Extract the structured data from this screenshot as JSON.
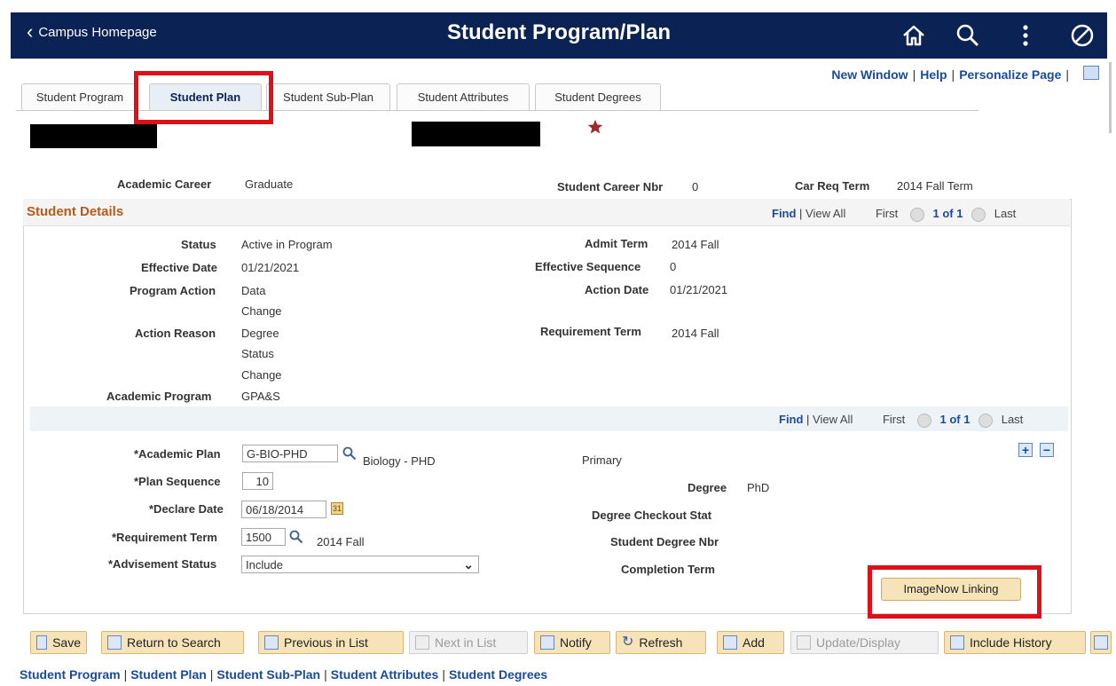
{
  "header": {
    "back_label": "Campus Homepage",
    "title": "Student Program/Plan"
  },
  "top_links": [
    "New Window",
    "Help",
    "Personalize Page"
  ],
  "tabs": [
    {
      "label": "Student Program"
    },
    {
      "label": "Student Plan"
    },
    {
      "label": "Student Sub-Plan"
    },
    {
      "label": "Student Attributes"
    },
    {
      "label": "Student Degrees"
    }
  ],
  "career": {
    "academic_career_label": "Academic Career",
    "academic_career": "Graduate",
    "career_nbr_label": "Student Career Nbr",
    "career_nbr": "0",
    "req_term_label": "Car Req Term",
    "req_term": "2014 Fall Term"
  },
  "details": {
    "header": "Student Details",
    "nav": {
      "find": "Find",
      "view_all": "View All",
      "first": "First",
      "count": "1 of 1",
      "last": "Last"
    },
    "status_label": "Status",
    "status": "Active in Program",
    "effective_date_label": "Effective Date",
    "effective_date": "01/21/2021",
    "program_action_label": "Program Action",
    "program_action_1": "Data",
    "program_action_2": "Change",
    "action_reason_label": "Action Reason",
    "action_reason_1": "Degree",
    "action_reason_2": "Status",
    "action_reason_3": "Change",
    "academic_program_label": "Academic Program",
    "academic_program": "GPA&S",
    "admit_term_label": "Admit Term",
    "admit_term": "2014 Fall",
    "effective_sequence_label": "Effective Sequence",
    "effective_sequence": "0",
    "action_date_label": "Action Date",
    "action_date": "01/21/2021",
    "requirement_term_label": "Requirement Term",
    "requirement_term": "2014 Fall"
  },
  "plan": {
    "nav": {
      "find": "Find",
      "view_all": "View All",
      "first": "First",
      "count": "1 of 1",
      "last": "Last"
    },
    "academic_plan_label": "*Academic Plan",
    "academic_plan": "G-BIO-PHD",
    "academic_plan_desc": "Biology - PHD",
    "plan_sequence_label": "*Plan Sequence",
    "plan_sequence": "10",
    "declare_date_label": "*Declare Date",
    "declare_date": "06/18/2014",
    "requirement_term_label": "*Requirement Term",
    "requirement_term": "1500",
    "requirement_term_desc": "2014 Fall",
    "advisement_status_label": "*Advisement Status",
    "advisement_status": "Include",
    "primary_label": "Primary",
    "degree_label": "Degree",
    "degree": "PhD",
    "degree_checkout_label": "Degree Checkout Stat",
    "student_degree_nbr_label": "Student Degree Nbr",
    "completion_term_label": "Completion Term",
    "imagenow_button": "ImageNow Linking"
  },
  "toolbar": {
    "save": "Save",
    "return_to_search": "Return to Search",
    "previous_in_list": "Previous in List",
    "next_in_list": "Next in List",
    "notify": "Notify",
    "refresh": "Refresh",
    "add": "Add",
    "update_display": "Update/Display",
    "include_history": "Include History"
  },
  "bottom_links": [
    "Student Program",
    "Student Plan",
    "Student Sub-Plan",
    "Student Attributes",
    "Student Degrees"
  ],
  "colors": {
    "header_bg": "#0a2354",
    "highlight_red": "#e0101a",
    "section_orange": "#b55a1a",
    "link_blue": "#1a4a9c",
    "button_tan": "#f7e3b8"
  }
}
